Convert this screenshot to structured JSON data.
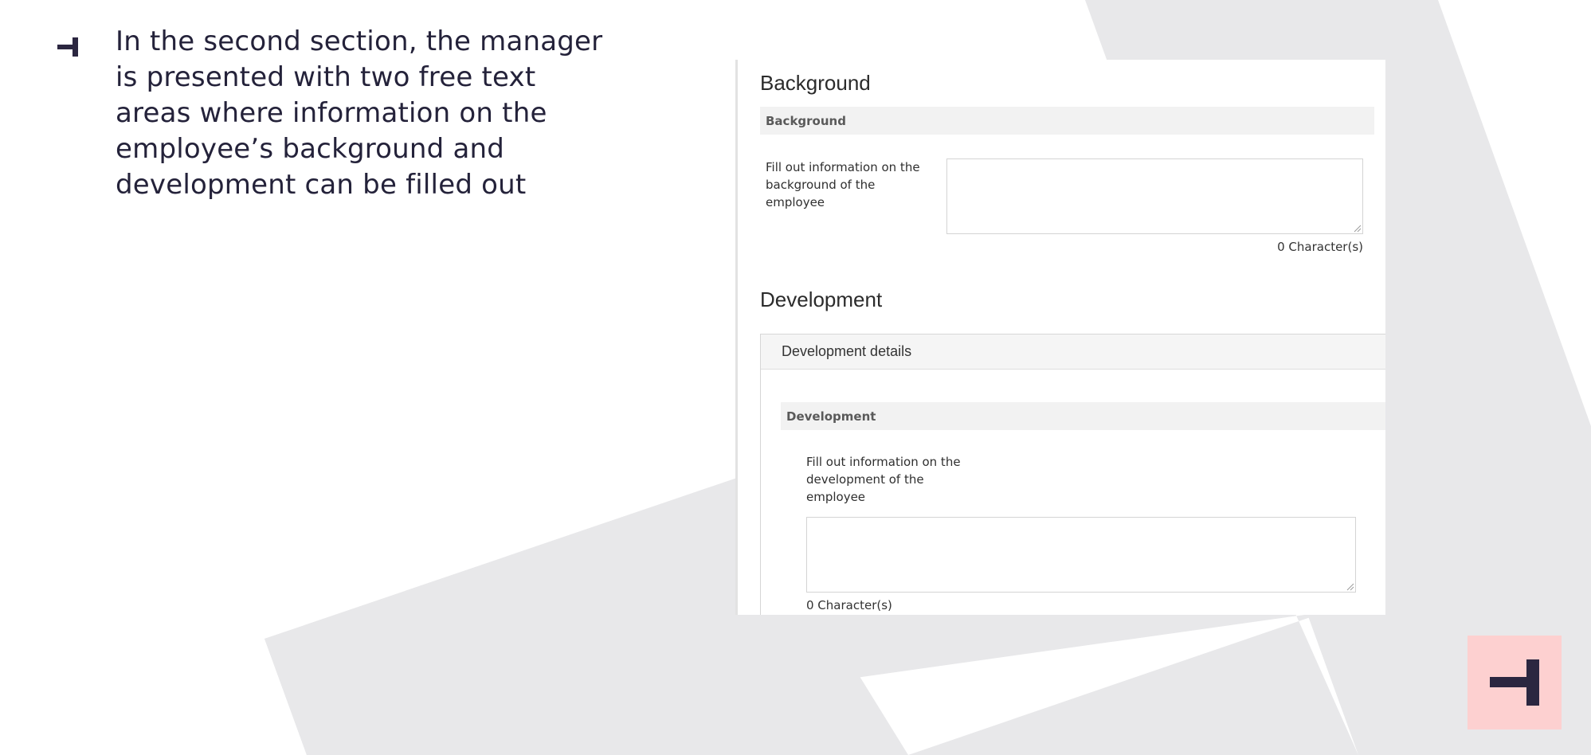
{
  "slide": {
    "caption": "In the second section, the manager is presented with two free text areas where information on the employee’s background and development can be filled out"
  },
  "background_section": {
    "title": "Background",
    "subheader": "Background",
    "field_label": "Fill out information on the background of the employee",
    "textarea_value": "",
    "char_count": "0 Character(s)"
  },
  "development_section": {
    "title": "Development",
    "card_header": "Development details",
    "subheader": "Development",
    "field_label": "Fill out information on the development of the employee",
    "textarea_value": "",
    "char_count": "0 Character(s)"
  },
  "colors": {
    "brand_dark": "#2b2640",
    "brand_pink": "#fdd0d0",
    "shape_gray": "#e8e8ea"
  },
  "icons": {
    "bullet": "brand-mark-icon",
    "logo": "brand-logo-icon"
  }
}
